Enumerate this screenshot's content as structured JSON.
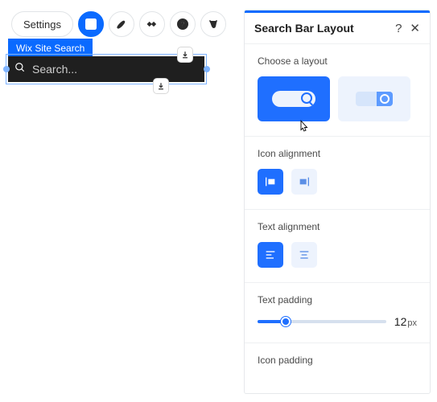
{
  "toolbar": {
    "settings_label": "Settings"
  },
  "canvas": {
    "widget_name": "Wix Site Search",
    "placeholder": "Search..."
  },
  "panel": {
    "title": "Search Bar Layout",
    "sections": {
      "layout": {
        "title": "Choose a layout"
      },
      "icon_align": {
        "title": "Icon alignment"
      },
      "text_align": {
        "title": "Text alignment"
      },
      "text_padding": {
        "title": "Text padding",
        "value": "12",
        "unit": "px",
        "percent": 22
      },
      "icon_padding": {
        "title": "Icon padding"
      }
    }
  }
}
